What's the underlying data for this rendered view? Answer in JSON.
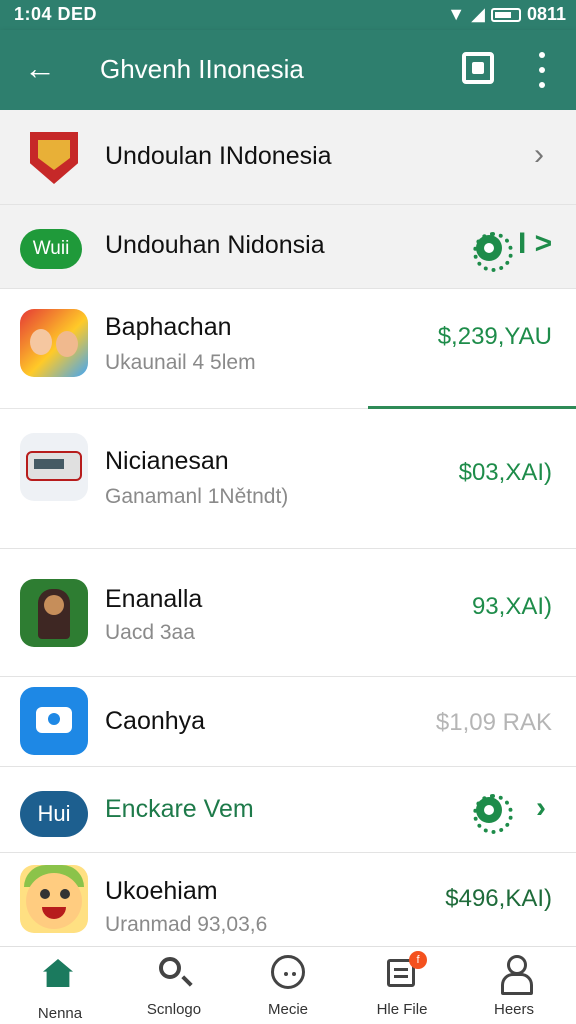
{
  "statusbar": {
    "time": "1:04 DED",
    "clock": "0811"
  },
  "appbar": {
    "title": "Ghvenh IInonesia"
  },
  "section1": {
    "label": "Undoulan INdonesia"
  },
  "section2": {
    "pill": "Wuii",
    "label": "Undouhan Nidonsia",
    "chevron": "I >"
  },
  "apps": [
    {
      "name": "Baphachan",
      "sub": "Ukaunail 4 5lem",
      "price": "$,239,YAU"
    },
    {
      "name": "Nicianesan",
      "sub": "Ganamanl 1Nětndt)",
      "price": "$03,XAI)"
    },
    {
      "name": "Enanalla",
      "sub": "Uacd 3aa",
      "price": "93,XAI)"
    },
    {
      "name": "Caonhya",
      "sub": "",
      "price": "$1,09 RAK"
    }
  ],
  "promo": {
    "pill": "Hui",
    "label": "Enckare Vem"
  },
  "app5": {
    "name": "Ukoehiam",
    "sub": "Uranmad 93,03,6",
    "price": "$496,KAI)"
  },
  "nav": [
    {
      "label": "Nenna"
    },
    {
      "label": "Scnlogo"
    },
    {
      "label": "Mecie"
    },
    {
      "label": "Hle File",
      "badge": "f"
    },
    {
      "label": "Heers"
    }
  ],
  "colors": {
    "primary": "#2e7f6e",
    "price_green": "#1e8c4a",
    "price_grey": "#b5b5b5"
  }
}
